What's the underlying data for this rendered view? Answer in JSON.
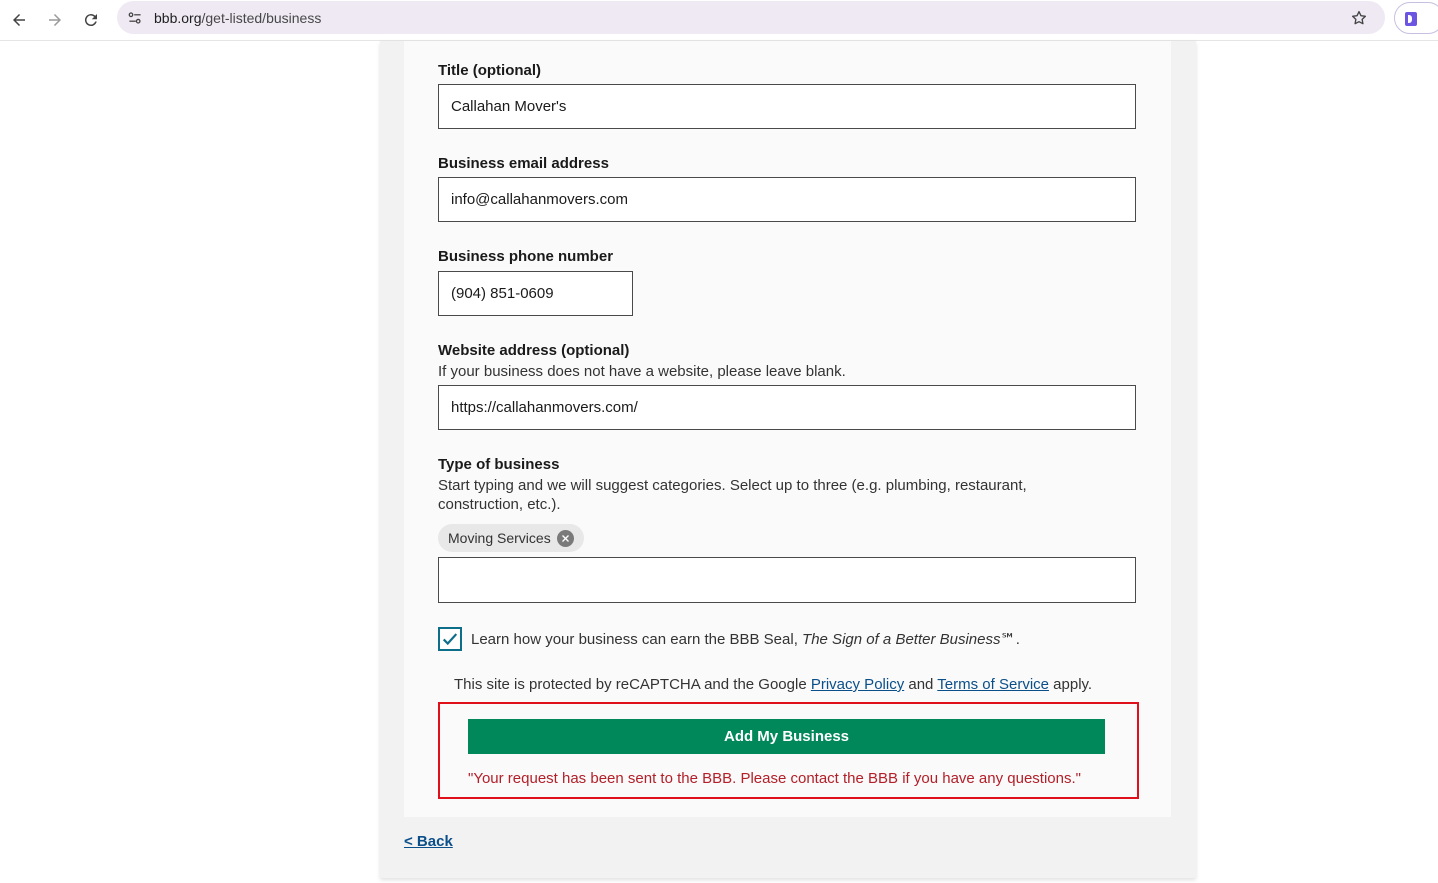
{
  "browser": {
    "url_domain": "bbb.org",
    "url_path": "/get-listed/business"
  },
  "form": {
    "title_field": {
      "label": "Title (optional)",
      "value": "Callahan Mover's"
    },
    "email_field": {
      "label": "Business email address",
      "value": "info@callahanmovers.com"
    },
    "phone_field": {
      "label": "Business phone number",
      "value": "(904) 851-0609"
    },
    "website_field": {
      "label": "Website address (optional)",
      "hint": "If your business does not have a website, please leave blank.",
      "value": "https://callahanmovers.com/"
    },
    "type_field": {
      "label": "Type of business",
      "hint": "Start typing and we will suggest categories. Select up to three (e.g. plumbing, restaurant, construction, etc.).",
      "chips": [
        "Moving Services"
      ],
      "value": ""
    },
    "seal_checkbox": {
      "checked": true,
      "label_prefix": "Learn how your business can earn the BBB Seal, ",
      "label_italic": "The Sign of a Better Business",
      "label_suffix": "℠."
    },
    "recaptcha": {
      "prefix": "This site is protected by reCAPTCHA and the Google ",
      "privacy_link": "Privacy Policy",
      "and": " and ",
      "terms_link": "Terms of Service",
      "suffix": " apply."
    },
    "submit_label": "Add My Business",
    "success_message": "\"Your request has been sent to the BBB. Please contact the BBB if you have any questions.\""
  },
  "back_link": "< Back",
  "colors": {
    "submit_bg": "#00875a",
    "highlight_border": "#e0101a",
    "message_text": "#b3202a",
    "link": "#0b4f8a",
    "checkbox": "#0d6e8a"
  }
}
